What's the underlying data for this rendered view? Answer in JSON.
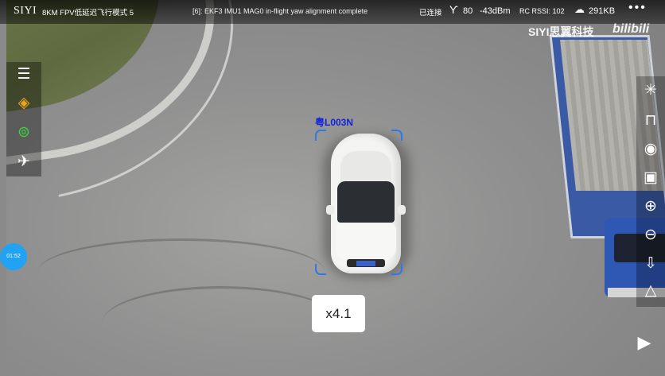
{
  "topbar": {
    "brand": "SIYI",
    "mode": "8KM FPV低延迟飞行模式 5",
    "message": "[6]: EKF3 IMU1 MAG0 in-flight yaw alignment complete",
    "connection": "已连接",
    "signal_icon": "signal-antenna-icon",
    "signal_value": "80",
    "dbm": "-43dBm",
    "rc_rssi": "RC RSSI: 102",
    "cloud_icon": "upload-cloud-icon",
    "data_rate": "291KB",
    "menu_icon": "more-dots-icon"
  },
  "watermark": {
    "brand_cn": "SIYI思翼科技",
    "bilibili": "bilibili"
  },
  "left_toolbar": {
    "items": [
      {
        "icon": "menu-list-icon",
        "glyph": "☰"
      },
      {
        "icon": "gimbal-diamond-icon",
        "glyph": "◈"
      },
      {
        "icon": "target-lock-icon",
        "glyph": "⊚"
      },
      {
        "icon": "aircraft-takeoff-icon",
        "glyph": "✈"
      }
    ]
  },
  "right_toolbar": {
    "items": [
      {
        "icon": "center-crosshair-icon",
        "glyph": "✳"
      },
      {
        "icon": "unlock-icon",
        "glyph": "⊓"
      },
      {
        "icon": "capture-photo-icon",
        "glyph": "◉"
      },
      {
        "icon": "record-stop-icon",
        "glyph": "▣"
      },
      {
        "icon": "zoom-in-icon",
        "glyph": "⊕"
      },
      {
        "icon": "zoom-out-icon",
        "glyph": "⊖"
      },
      {
        "icon": "down-arrow-icon",
        "glyph": "⇩"
      },
      {
        "icon": "mountain-terrain-icon",
        "glyph": "△"
      }
    ]
  },
  "timer": "01:52",
  "zoom_label": "x4.1",
  "tracking": {
    "plate": "粤L003N"
  },
  "tv_icon": "tv-playback-icon",
  "colors": {
    "accent_blue": "#2f78e8",
    "timer_blue": "#21a2f3",
    "plate_blue": "#1224d9"
  }
}
